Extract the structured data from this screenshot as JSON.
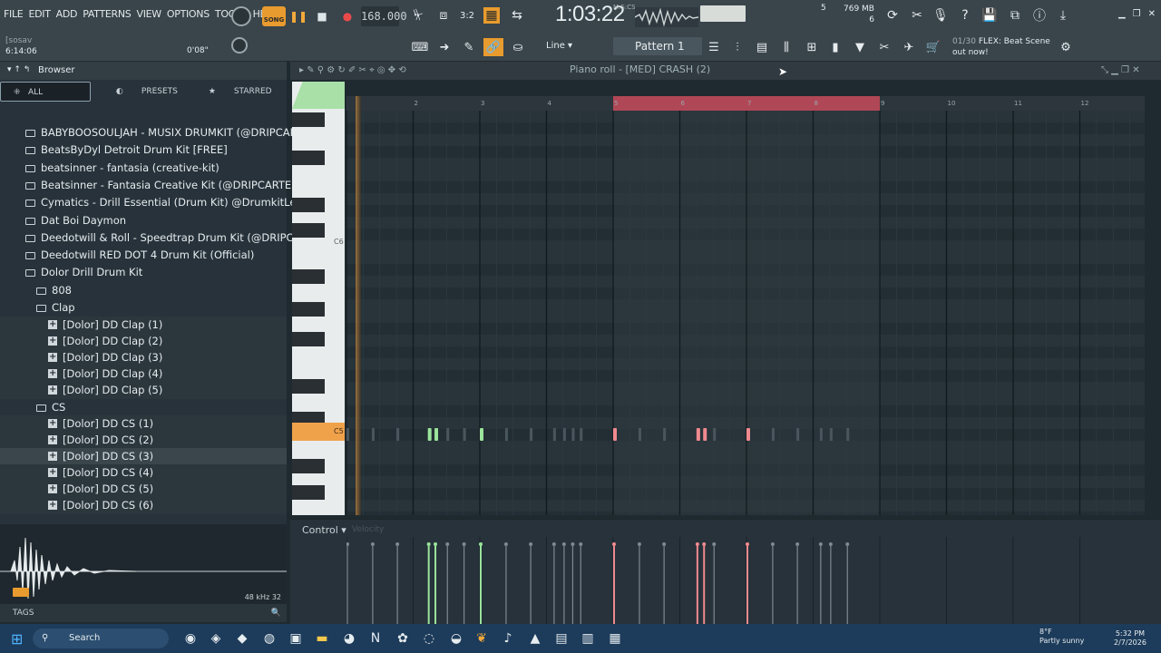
{
  "menu": [
    "FILE",
    "EDIT",
    "ADD",
    "PATTERNS",
    "VIEW",
    "OPTIONS",
    "TOOLS",
    "HELP"
  ],
  "transport": {
    "song_label": "SONG",
    "pat_label": "PAT",
    "tempo": "168.000",
    "time": "1:03",
    "time_fraction": "22",
    "time_unit": "M:S:CS"
  },
  "cpu": {
    "ram": "769 MB",
    "polyphony": "5",
    "cpu_value": "6"
  },
  "hint": {
    "user": "[sosav",
    "duration": "6:14:06",
    "time_display": "0'08\""
  },
  "snap": {
    "label": "Line"
  },
  "pattern": {
    "label": "Pattern 1"
  },
  "news": {
    "count": "01/30",
    "text": "FLEX: Beat Scene",
    "sub": "out now!"
  },
  "browser": {
    "title": "Browser",
    "tabs": {
      "all": "ALL",
      "presets": "PRESETS",
      "starred": "STARRED"
    },
    "items": [
      {
        "label": "BABYBOOSOULJAH - MUSIX DRUMKIT (@DRIPCARTEL)",
        "type": "folder",
        "indent": 1
      },
      {
        "label": "BeatsByDyl Detroit Drum Kit [FREE]",
        "type": "folder",
        "indent": 1
      },
      {
        "label": "beatsinner - fantasia (creative-kit)",
        "type": "folder",
        "indent": 1
      },
      {
        "label": "Beatsinner - Fantasia Creative Kit (@DRIPCARTEL)",
        "type": "folder",
        "indent": 1
      },
      {
        "label": "Cymatics - Drill Essential (Drum Kit) @DrumkitLeaks",
        "type": "folder",
        "indent": 1
      },
      {
        "label": "Dat Boi Daymon",
        "type": "folder",
        "indent": 1
      },
      {
        "label": "Deedotwill & Roll - Speedtrap Drum Kit (@DRIPCARTEL)",
        "type": "folder",
        "indent": 1
      },
      {
        "label": "Deedotwill RED DOT 4 Drum Kit (Official)",
        "type": "folder",
        "indent": 1
      },
      {
        "label": "Dolor Drill Drum Kit",
        "type": "folder",
        "indent": 1
      },
      {
        "label": "808",
        "type": "folder",
        "indent": 2
      },
      {
        "label": "Clap",
        "type": "folder",
        "indent": 2
      },
      {
        "label": "[Dolor] DD Clap (1)",
        "type": "wav",
        "indent": 3
      },
      {
        "label": "[Dolor] DD Clap (2)",
        "type": "wav",
        "indent": 3
      },
      {
        "label": "[Dolor] DD Clap (3)",
        "type": "wav",
        "indent": 3
      },
      {
        "label": "[Dolor] DD Clap (4)",
        "type": "wav",
        "indent": 3
      },
      {
        "label": "[Dolor] DD Clap (5)",
        "type": "wav",
        "indent": 3
      },
      {
        "label": "CS",
        "type": "folder",
        "indent": 2
      },
      {
        "label": "[Dolor] DD CS (1)",
        "type": "wav",
        "indent": 3
      },
      {
        "label": "[Dolor] DD CS (2)",
        "type": "wav",
        "indent": 3
      },
      {
        "label": "[Dolor] DD CS (3)",
        "type": "wav",
        "indent": 3,
        "selected": true
      },
      {
        "label": "[Dolor] DD CS (4)",
        "type": "wav",
        "indent": 3
      },
      {
        "label": "[Dolor] DD CS (5)",
        "type": "wav",
        "indent": 3
      },
      {
        "label": "[Dolor] DD CS (6)",
        "type": "wav",
        "indent": 3
      }
    ],
    "sample_rate": "48 kHz 32",
    "tags_label": "TAGS"
  },
  "piano_roll": {
    "title": "Piano roll - [MED] CRASH (2)",
    "ruler": [
      "2",
      "3",
      "4",
      "5",
      "6",
      "7",
      "8",
      "9",
      "10",
      "11",
      "12"
    ],
    "key_labels": {
      "c6": "C6",
      "c5": "C5"
    },
    "control_label": "Control",
    "velocity_label": "Velocity",
    "loop_start_bar": 5,
    "loop_end_bar": 9,
    "notes": [
      {
        "bar": 2.22,
        "color": "green"
      },
      {
        "bar": 2.32,
        "color": "green"
      },
      {
        "bar": 3.0,
        "color": "green"
      },
      {
        "bar": 5.0,
        "color": "red"
      },
      {
        "bar": 6.25,
        "color": "red"
      },
      {
        "bar": 6.35,
        "color": "red"
      },
      {
        "bar": 7.0,
        "color": "red"
      }
    ],
    "ghost_notes": [
      1.0,
      1.38,
      1.75,
      2.5,
      2.75,
      3.38,
      3.75,
      4.1,
      4.25,
      4.38,
      4.5,
      5.38,
      5.75,
      6.5,
      7.38,
      7.75,
      8.1,
      8.25,
      8.5
    ],
    "colors": {
      "green": "#9be39b",
      "red": "#f08a8f",
      "ghost": "#4a565d",
      "loop": "#c84a5a",
      "accent": "#f0a24a"
    }
  },
  "taskbar": {
    "search": "Search",
    "weather": {
      "temp": "8°F",
      "desc": "Partly sunny"
    },
    "clock": {
      "time": "5:32 PM",
      "date": "2/7/2026"
    }
  }
}
